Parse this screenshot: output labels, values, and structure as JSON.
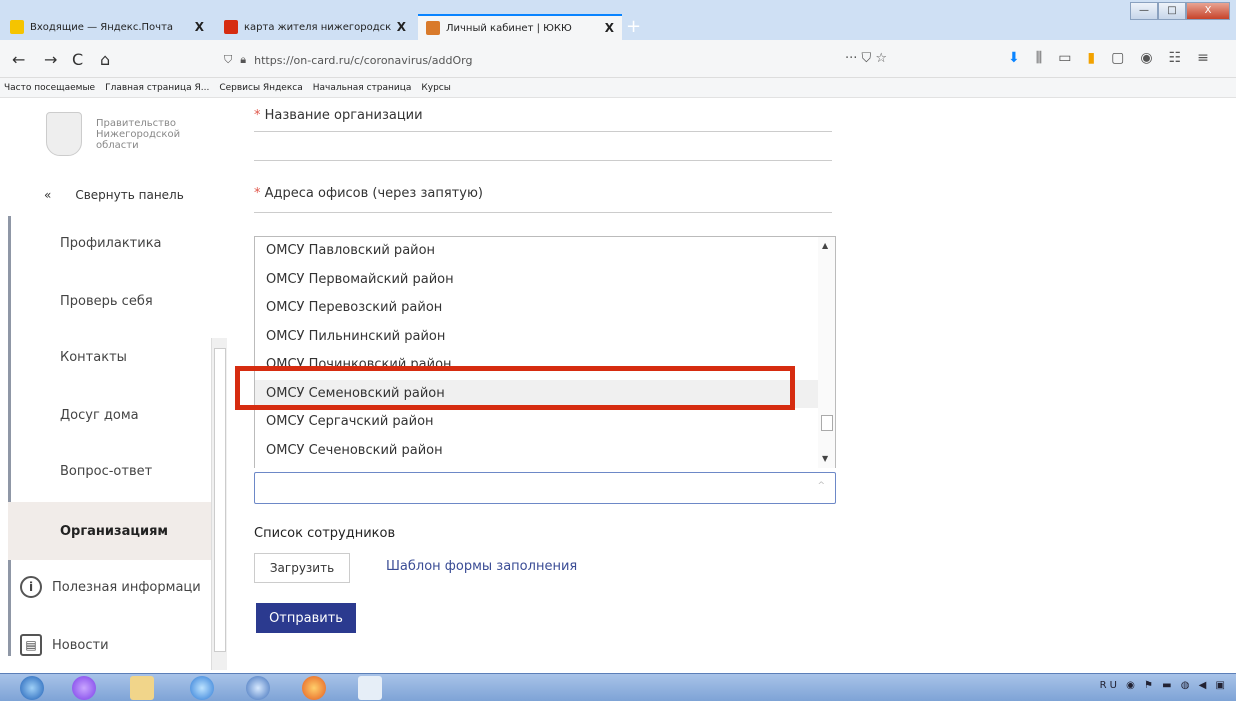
{
  "browser": {
    "tabs": [
      {
        "label": "Входящие — Яндекс.Почта",
        "close": "X",
        "favicon_color": "#f5c400"
      },
      {
        "label": "карта жителя нижегородской",
        "close": "X",
        "favicon_color": "#d62c10"
      },
      {
        "label": "Личный кабинет | ЮКЮ",
        "close": "X",
        "favicon_color": "#d97a2b"
      }
    ],
    "new_tab": "+",
    "url": "https://on-card.ru/c/coronavirus/addOrg",
    "url_right": "··· ⛉ ☆",
    "window_controls": {
      "minimize": "—",
      "maximize": "□",
      "close": "X"
    },
    "nav": {
      "back": "←",
      "forward": "→",
      "reload": "C",
      "home": "⌂"
    },
    "tool_icons": [
      "⬇",
      "⫼",
      "▭",
      "▮",
      "▢",
      "◉",
      "☷",
      "≡"
    ],
    "bookmarks": [
      "Часто посещаемые",
      "Главная страница Я...",
      "Сервисы Яндекса",
      "Начальная страница",
      "Курсы"
    ]
  },
  "sidebar": {
    "logo_text": [
      "Правительство",
      "Нижегородской",
      "области"
    ],
    "collapse_icon": "«",
    "collapse_label": "Свернуть панель",
    "items": [
      {
        "label": "Профилактика"
      },
      {
        "label": "Проверь себя"
      },
      {
        "label": "Контакты"
      },
      {
        "label": "Досуг дома"
      },
      {
        "label": "Вопрос-ответ"
      },
      {
        "label": "Организациям"
      }
    ],
    "info_icon": "i",
    "info_label": "Полезная информаци",
    "news_icon": "▤",
    "news_label": "Новости"
  },
  "form": {
    "org_name_label": "Название организации",
    "address_label": "Адреса офисов (через запятую)",
    "required_mark": "*",
    "options": [
      "ОМСУ Павловский район",
      "ОМСУ Первомайский район",
      "ОМСУ Перевозский район",
      "ОМСУ Пильнинский район",
      "ОМСУ Починковский район",
      "ОМСУ Семеновский район",
      "ОМСУ Сергачский район",
      "ОМСУ Сеченовский район"
    ],
    "selected_option": "ОМСУ Семеновский район",
    "select_caret": "^",
    "employees_label": "Список сотрудников",
    "upload_button": "Загрузить",
    "template_link": "Шаблон формы заполнения",
    "submit_button": "Отправить"
  },
  "colors": {
    "highlight": "#d62c10",
    "submit": "#2b3a8f",
    "link": "#3a4c95",
    "active_item_bg": "#f1ece9"
  }
}
